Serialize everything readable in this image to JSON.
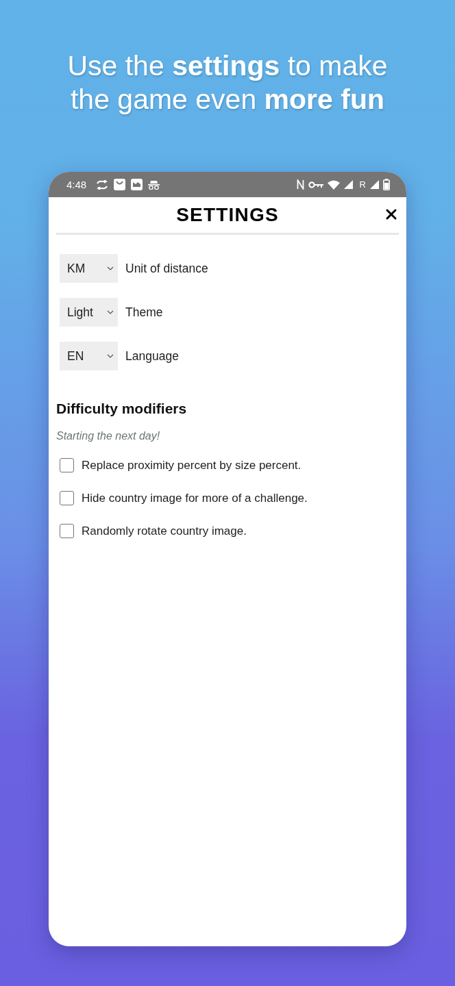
{
  "headline": "Use the **settings** to make the game even **more fun**",
  "status_bar": {
    "time": "4:48",
    "roaming": "R"
  },
  "dialog": {
    "title": "SETTINGS"
  },
  "settings": [
    {
      "value": "KM",
      "label": "Unit of distance"
    },
    {
      "value": "Light",
      "label": "Theme"
    },
    {
      "value": "EN",
      "label": "Language"
    }
  ],
  "difficulty": {
    "title": "Difficulty modifiers",
    "note": "Starting the next day!",
    "options": [
      {
        "label": "Replace proximity percent by size percent.",
        "checked": false
      },
      {
        "label": "Hide country image for more of a challenge.",
        "checked": false
      },
      {
        "label": "Randomly rotate country image.",
        "checked": false
      }
    ]
  }
}
